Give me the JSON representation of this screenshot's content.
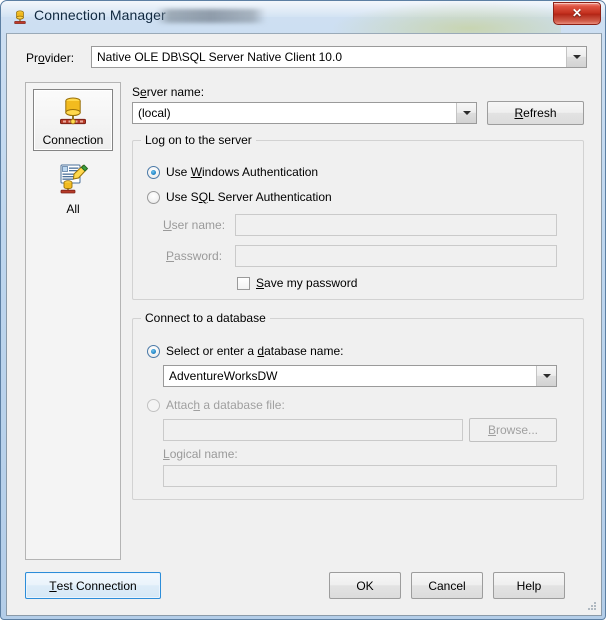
{
  "window": {
    "title": "Connection Manager",
    "title_icon": "connection-manager-icon",
    "redacted_title_suffix": "",
    "close_label": "✕",
    "accent_blue": "#2c8dd9",
    "titlebar_color": "#bed6ee",
    "dialog_background": "#f0f0f0"
  },
  "provider": {
    "label_pre": "Pr",
    "label_accel": "o",
    "label_post": "vider:",
    "value": "Native OLE DB\\SQL Server Native Client 10.0"
  },
  "sidebar": {
    "items": [
      {
        "label": "Connection",
        "icon": "database-connection-icon",
        "selected": true
      },
      {
        "label": "All",
        "icon": "all-properties-icon",
        "selected": false
      }
    ]
  },
  "server": {
    "label_pre": "S",
    "label_accel": "e",
    "label_post": "rver name:",
    "value": "(local)",
    "refresh_pre": "",
    "refresh_accel": "R",
    "refresh_post": "efresh"
  },
  "logon": {
    "group_title": "Log on to the server",
    "windows_auth": {
      "pre": "Use ",
      "accel": "W",
      "post": "indows Authentication",
      "selected": true
    },
    "sql_auth": {
      "pre": "Use S",
      "accel": "Q",
      "post": "L Server Authentication",
      "selected": false
    },
    "user_name": {
      "pre": "",
      "accel": "U",
      "post": "ser name:",
      "value": "",
      "disabled": true
    },
    "password": {
      "pre": "",
      "accel": "P",
      "post": "assword:",
      "value": "",
      "disabled": true
    },
    "save_password": {
      "pre": "",
      "accel": "S",
      "post": "ave my password",
      "checked": false
    }
  },
  "database": {
    "group_title": "Connect to a database",
    "select_db": {
      "pre": "Select or enter a ",
      "accel": "d",
      "post": "atabase name:",
      "selected": true,
      "value": "AdventureWorksDW"
    },
    "attach_db": {
      "pre": "Attac",
      "accel": "h",
      "post": " a database file:",
      "selected": false,
      "value": "",
      "browse_pre": "",
      "browse_accel": "B",
      "browse_post": "rowse..."
    },
    "logical_name": {
      "pre": "",
      "accel": "L",
      "post": "ogical name:",
      "value": "",
      "disabled": true
    }
  },
  "footer": {
    "test_connection": {
      "pre": "",
      "accel": "T",
      "post": "est Connection",
      "is_default": true
    },
    "ok": "OK",
    "cancel": "Cancel",
    "help": "Help"
  }
}
